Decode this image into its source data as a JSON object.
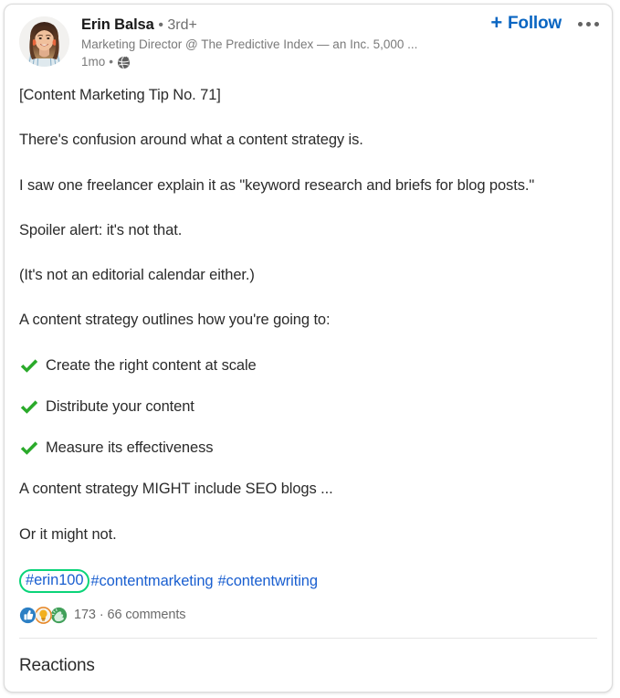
{
  "post": {
    "author": {
      "name": "Erin Balsa",
      "degree": "• 3rd+",
      "headline": "Marketing Director @ The Predictive Index — an Inc. 5,000 ...",
      "timestamp": "1mo",
      "meta_separator": "•",
      "visibility_icon": "globe-icon",
      "avatar_alt": "Erin Balsa profile photo"
    },
    "actions": {
      "follow_plus": "+",
      "follow_label": "Follow",
      "overflow_label": "More actions"
    },
    "body_paragraphs": [
      "[Content Marketing Tip No. 71]",
      "There's confusion around what a content strategy is.",
      "I saw one freelancer explain it as \"keyword research and briefs for blog posts.\"",
      "Spoiler alert: it's not that.",
      "(It's not an editorial calendar either.)",
      "A content strategy outlines how you're going to:"
    ],
    "bullets": [
      {
        "icon": "check-mark-icon",
        "text": "Create the right content at scale"
      },
      {
        "icon": "check-mark-icon",
        "text": "Distribute your content"
      },
      {
        "icon": "check-mark-icon",
        "text": "Measure its effectiveness"
      }
    ],
    "body_paragraphs_after": [
      "A content strategy MIGHT include SEO blogs ...",
      "Or it might not."
    ],
    "hashtags": [
      {
        "label": "#erin100",
        "highlighted": true
      },
      {
        "label": "#contentmarketing",
        "highlighted": false
      },
      {
        "label": "#contentwriting",
        "highlighted": false
      }
    ],
    "engagement": {
      "reactions": [
        {
          "name": "like-reaction-icon",
          "label": "Like"
        },
        {
          "name": "insightful-reaction-icon",
          "label": "Insightful"
        },
        {
          "name": "celebrate-reaction-icon",
          "label": "Celebrate"
        }
      ],
      "reaction_count": "173",
      "separator": "·",
      "comments_text": "66 comments",
      "counts_combined": "173 · 66 comments"
    },
    "footer": {
      "reactions_heading": "Reactions"
    }
  },
  "colors": {
    "linkedin_blue": "#0a66c2",
    "hashtag_blue": "#1a5fd0",
    "highlight_green": "#0bd479",
    "check_green": "#2aaa2a",
    "text_primary": "#2b2b2b",
    "text_secondary": "#7a7a7a",
    "card_border": "#dcdcdc"
  }
}
